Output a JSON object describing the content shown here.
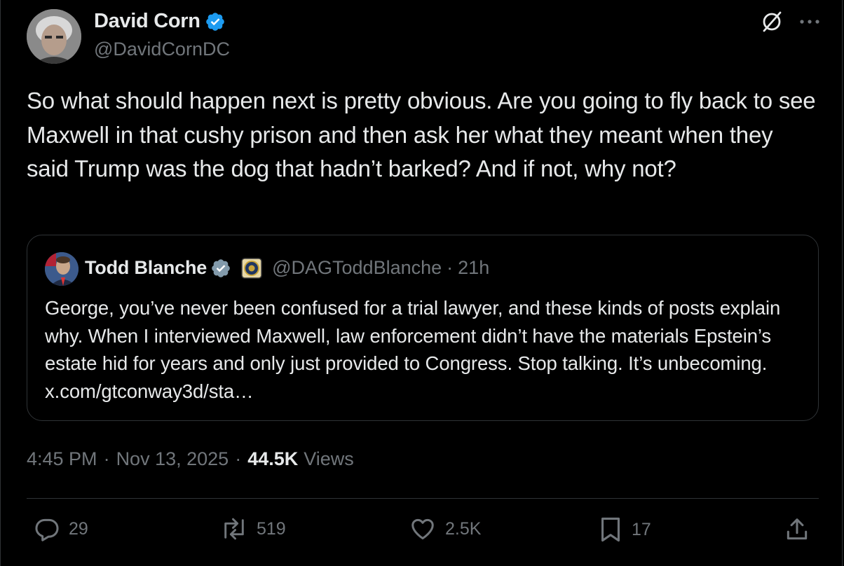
{
  "author": {
    "name": "David Corn",
    "handle": "@DavidCornDC"
  },
  "tweet": {
    "text": "So what should happen next is pretty obvious. Are you going to fly back to see Maxwell in that cushy prison and then ask her what they meant when they said Trump was the dog that hadn’t barked? And if not, why not?"
  },
  "quote": {
    "name": "Todd Blanche",
    "handle": "@DAGToddBlanche",
    "separator": "·",
    "time": "21h",
    "text": "George, you’ve never been confused for a trial lawyer, and these kinds of posts explain why. When I interviewed Maxwell, law enforcement didn’t have the materials Epstein’s estate hid for years and only just provided to Congress. Stop talking. It’s unbecoming. x.com/gtconway3d/sta…"
  },
  "meta": {
    "time": "4:45 PM",
    "sep1": "·",
    "date": "Nov 13, 2025",
    "sep2": "·",
    "views_count": "44.5K",
    "views_label": "Views"
  },
  "actions": {
    "replies": "29",
    "reposts": "519",
    "likes": "2.5K",
    "bookmarks": "17"
  },
  "icons": {
    "verified": "verified-badge-icon",
    "grok": "slashed-circle-icon",
    "more": "more-dots-icon",
    "gov_badge": "doj-seal-icon",
    "reply": "reply-bubble-icon",
    "repost": "repost-icon",
    "like": "heart-icon",
    "bookmark": "bookmark-icon",
    "share": "share-icon"
  },
  "colors": {
    "background": "#000000",
    "text": "#e7e9ea",
    "muted": "#71767b",
    "border": "#2f3336",
    "verified_blue": "#1d9bf0",
    "verified_gray": "#829aab"
  }
}
